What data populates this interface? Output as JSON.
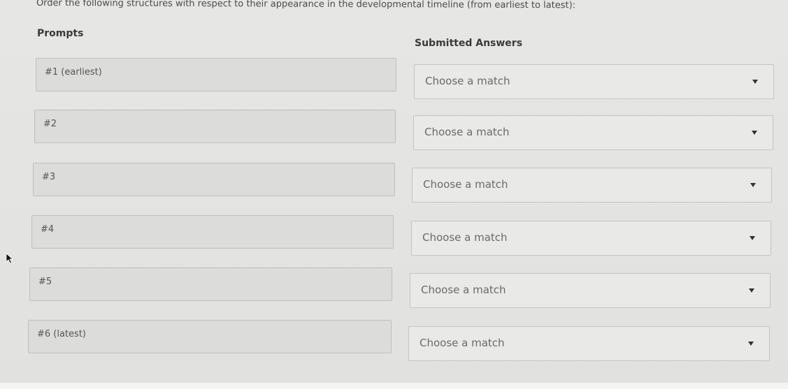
{
  "instruction": "Order the following structures with respect to their appearance in the developmental timeline (from earliest to latest):",
  "headings": {
    "prompts": "Prompts",
    "answers": "Submitted Answers"
  },
  "rows": [
    {
      "prompt": "#1 (earliest)",
      "answer": "Choose a match"
    },
    {
      "prompt": "#2",
      "answer": "Choose a match"
    },
    {
      "prompt": "#3",
      "answer": "Choose a match"
    },
    {
      "prompt": "#4",
      "answer": "Choose a match"
    },
    {
      "prompt": "#5",
      "answer": "Choose a match"
    },
    {
      "prompt": "#6 (latest)",
      "answer": "Choose a match"
    }
  ],
  "icons": {
    "dropdown": "chevron-down-icon",
    "pointer": "mouse-pointer-icon"
  }
}
